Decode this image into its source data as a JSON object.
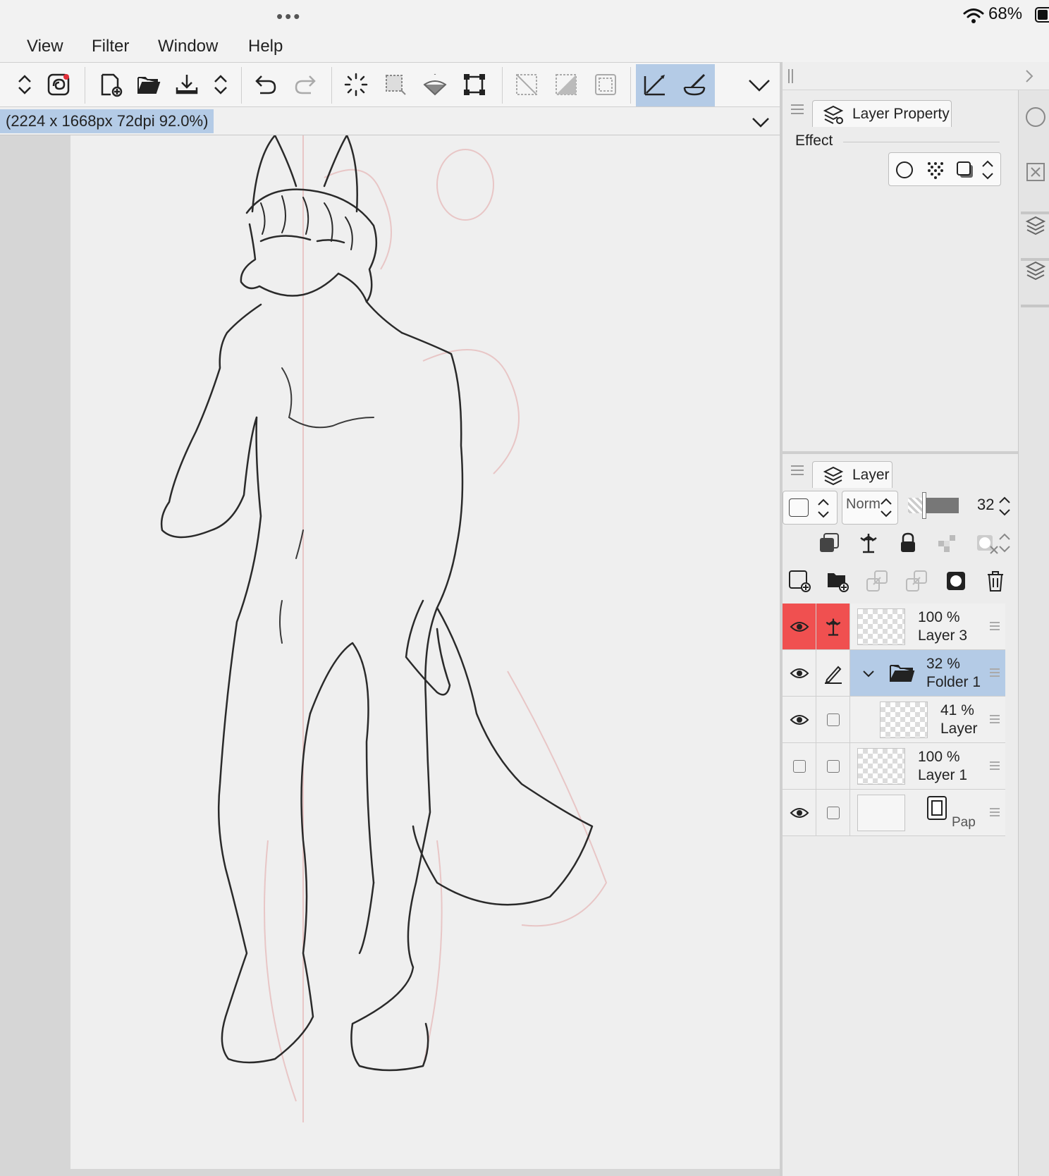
{
  "status": {
    "battery": "68%"
  },
  "menu": [
    "View",
    "Filter",
    "Window",
    "Help"
  ],
  "document": {
    "title": "(2224 x 1668px 72dpi 92.0%)"
  },
  "layer_property": {
    "tab_label": "Layer Property",
    "effect_label": "Effect"
  },
  "layer_panel": {
    "tab_label": "Layer",
    "blend_mode": "Norm",
    "opacity": "32",
    "layers": [
      {
        "opacity": "100 %",
        "name": "Layer 3",
        "visible": true,
        "selected": false,
        "reference": true
      },
      {
        "opacity": "32 %",
        "name": "Folder 1",
        "visible": true,
        "selected": true,
        "folder": true
      },
      {
        "opacity": "41 %",
        "name": "Layer",
        "visible": true,
        "selected": false
      },
      {
        "opacity": "100 %",
        "name": "Layer 1",
        "visible": false,
        "selected": false
      },
      {
        "opacity": "",
        "name": "Pap",
        "visible": true,
        "selected": false,
        "paper": true
      }
    ]
  },
  "colors": {
    "selection": "#b4cbe6",
    "reference_active": "#f05050",
    "panel_bg": "#ececec",
    "canvas_bg": "#efefef"
  },
  "icons": [
    "undo-icon",
    "redo-icon",
    "layer-icon",
    "eye-icon",
    "folder-icon",
    "trash-icon",
    "lock-icon",
    "pen-icon"
  ]
}
